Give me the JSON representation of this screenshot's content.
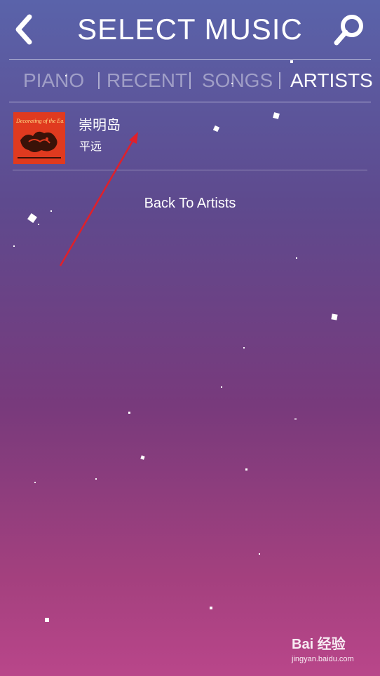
{
  "header": {
    "title": "SELECT MUSIC",
    "back_icon": "chevron-left-icon",
    "search_icon": "search-icon"
  },
  "tabs": [
    {
      "label": "PIANO",
      "active": false
    },
    {
      "label": "RECENT",
      "active": false
    },
    {
      "label": "SONGS",
      "active": false
    },
    {
      "label": "ARTISTS",
      "active": true
    }
  ],
  "tracks": [
    {
      "title": "崇明岛",
      "artist": "平远",
      "album_cover_text": "Decorating of the East",
      "album_cover_color": "#e03a1f"
    }
  ],
  "back_link": "Back To Artists",
  "watermark": {
    "brand": "Bai 经验",
    "url": "jingyan.baidu.com"
  },
  "colors": {
    "background_top": "#5a63aa",
    "background_bottom": "#b9468a",
    "annotation_arrow": "#e0202a"
  }
}
